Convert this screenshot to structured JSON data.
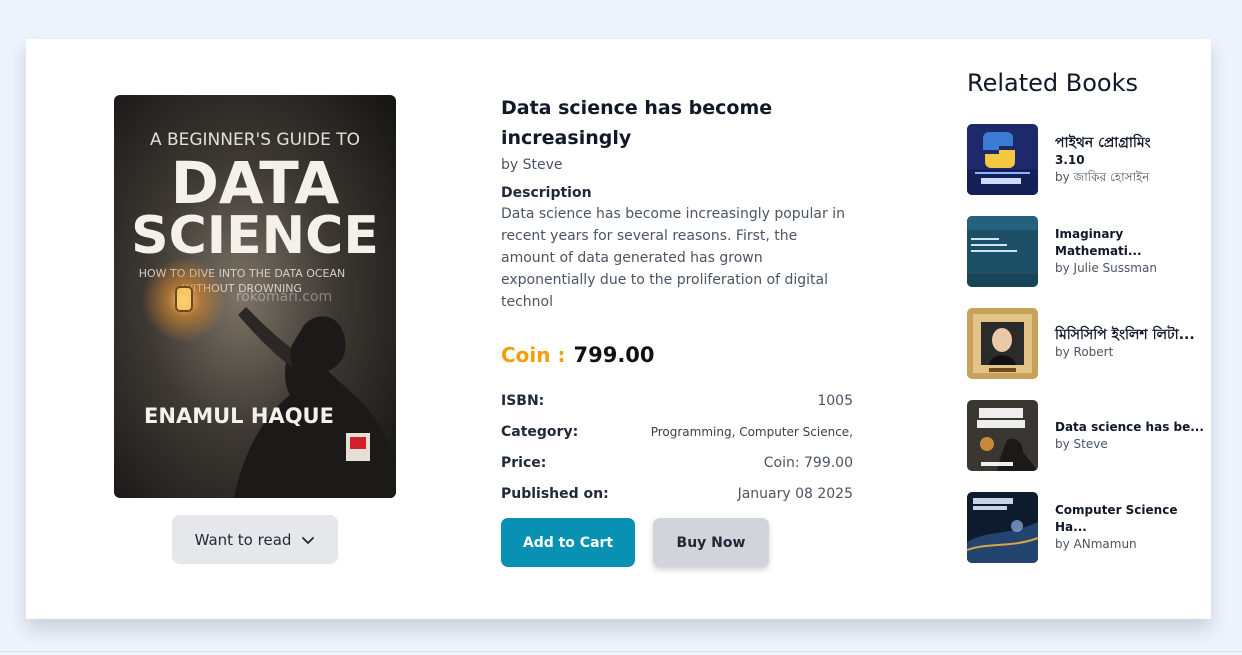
{
  "book": {
    "title": "Data science has become increasingly",
    "author": "by Steve",
    "description_label": "Description",
    "description": "Data science has become increasingly popular in recent years for several reasons. First, the amount of data generated has grown exponentially due to the proliferation of digital technol",
    "coin_label": "Coin :",
    "coin_value": "799.00",
    "cover": {
      "top_text": "A BEGINNER'S GUIDE TO",
      "line1": "DATA",
      "line2": "SCIENCE",
      "subtitle1": "HOW TO DIVE INTO THE DATA OCEAN",
      "subtitle2": "WITHOUT DROWNING",
      "watermark": "rokomari.com",
      "author_name": "ENAMUL HAQUE"
    }
  },
  "info": [
    {
      "key": "ISBN:",
      "value": "1005"
    },
    {
      "key": "Category:",
      "value": "Programming, Computer Science,"
    },
    {
      "key": "Price:",
      "value": "Coin: 799.00"
    },
    {
      "key": "Published on:",
      "value": "January 08 2025"
    }
  ],
  "buttons": {
    "want_to_read": "Want to read",
    "add_to_cart": "Add to Cart",
    "buy_now": "Buy Now"
  },
  "related": {
    "title": "Related Books",
    "items": [
      {
        "title": "পাইথন প্রোগ্রামিং 3.10",
        "title_line1": "পাইথন প্রোগ্রামিং",
        "title_line2": "3.10",
        "author": "by জাকির হোসাইন"
      },
      {
        "title": "Imaginary Mathemati...",
        "author": "by Julie Sussman"
      },
      {
        "title": "মিসিসিপি ইংলিশ লিটা...",
        "author": "by Robert"
      },
      {
        "title": "Data science has be...",
        "author": "by Steve"
      },
      {
        "title": "Computer Science Ha...",
        "author": "by ANmamun"
      }
    ]
  },
  "colors": {
    "accent_coin": "#f59e0b",
    "cart_button": "#0891b2",
    "page_bg": "#eef4fd"
  },
  "icons": {
    "dropdown": "chevron-down-icon"
  }
}
